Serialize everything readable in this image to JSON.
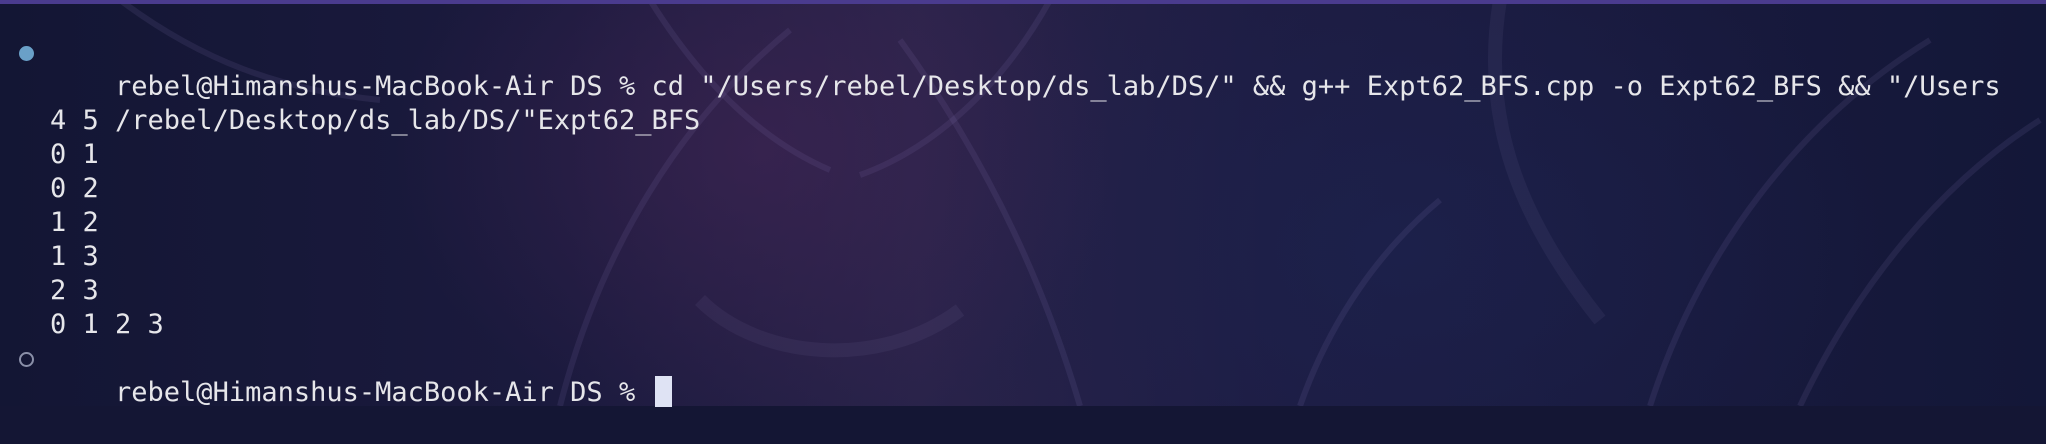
{
  "terminal": {
    "command_line_1": "rebel@Himanshus-MacBook-Air DS % cd \"/Users/rebel/Desktop/ds_lab/DS/\" && g++ Expt62_BFS.cpp -o Expt62_BFS && \"/Users",
    "command_line_2": "/rebel/Desktop/ds_lab/DS/\"Expt62_BFS",
    "output": [
      "4 5",
      "0 1",
      "0 2",
      "1 2",
      "1 3",
      "2 3",
      "0 1 2 3"
    ],
    "prompt": "rebel@Himanshus-MacBook-Air DS % "
  },
  "theme": {
    "background": "#141634",
    "text": "#e6e6ea",
    "cursor": "#dfe3f4",
    "success_marker": "#6aa0c8",
    "idle_marker": "#8a8fa8",
    "border_accent": "#4a3b8e"
  }
}
